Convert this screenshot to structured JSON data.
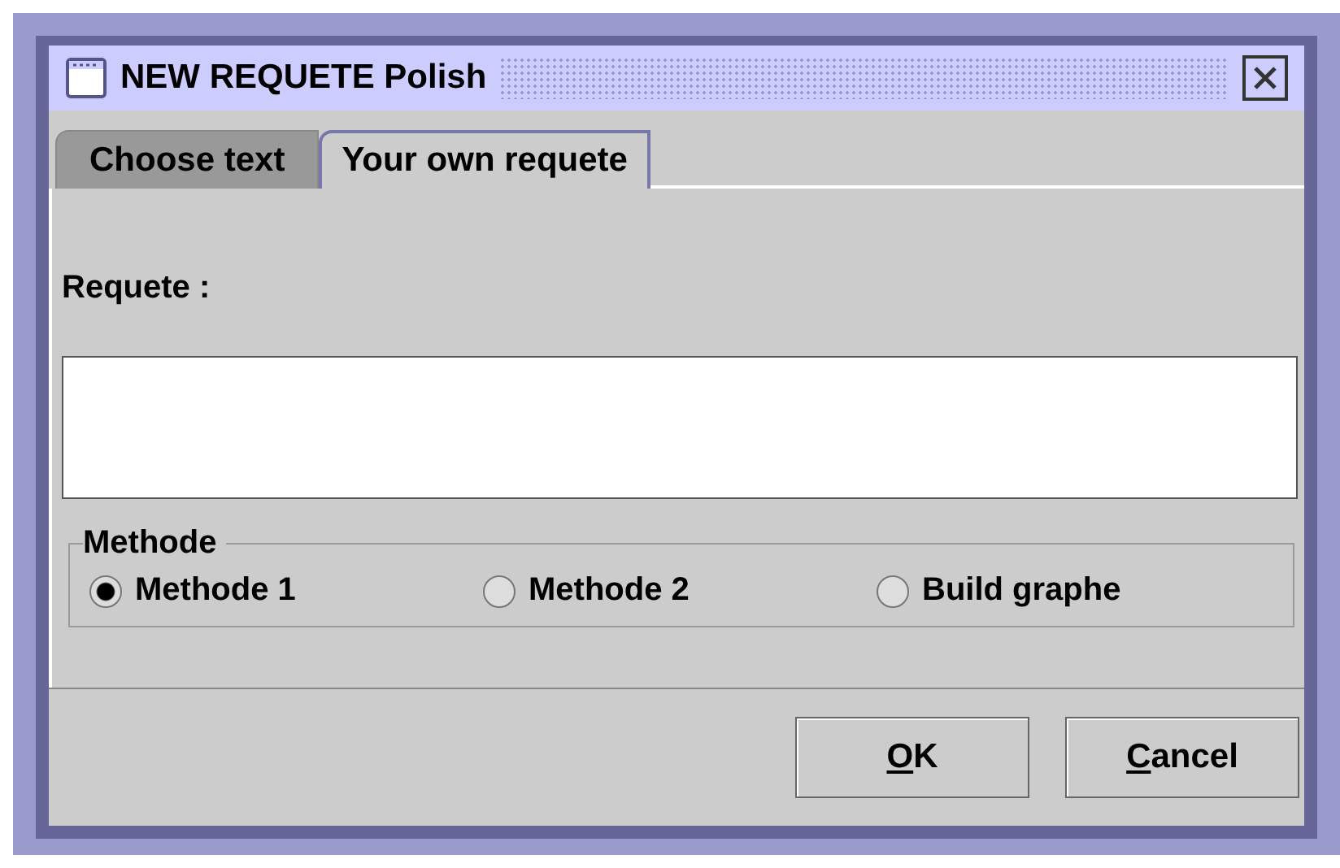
{
  "window": {
    "title": "NEW REQUETE Polish"
  },
  "tabs": [
    {
      "label": "Choose text",
      "selected": false
    },
    {
      "label": "Your own requete",
      "selected": true
    }
  ],
  "requete": {
    "label": "Requete :"
  },
  "methode": {
    "title": "Methode",
    "options": [
      {
        "label": "Methode 1",
        "selected": true
      },
      {
        "label": "Methode 2",
        "selected": false
      },
      {
        "label": "Build graphe",
        "selected": false
      }
    ]
  },
  "buttons": [
    {
      "mnemonic": "O",
      "rest": "K"
    },
    {
      "mnemonic": "C",
      "rest": "ancel"
    }
  ]
}
